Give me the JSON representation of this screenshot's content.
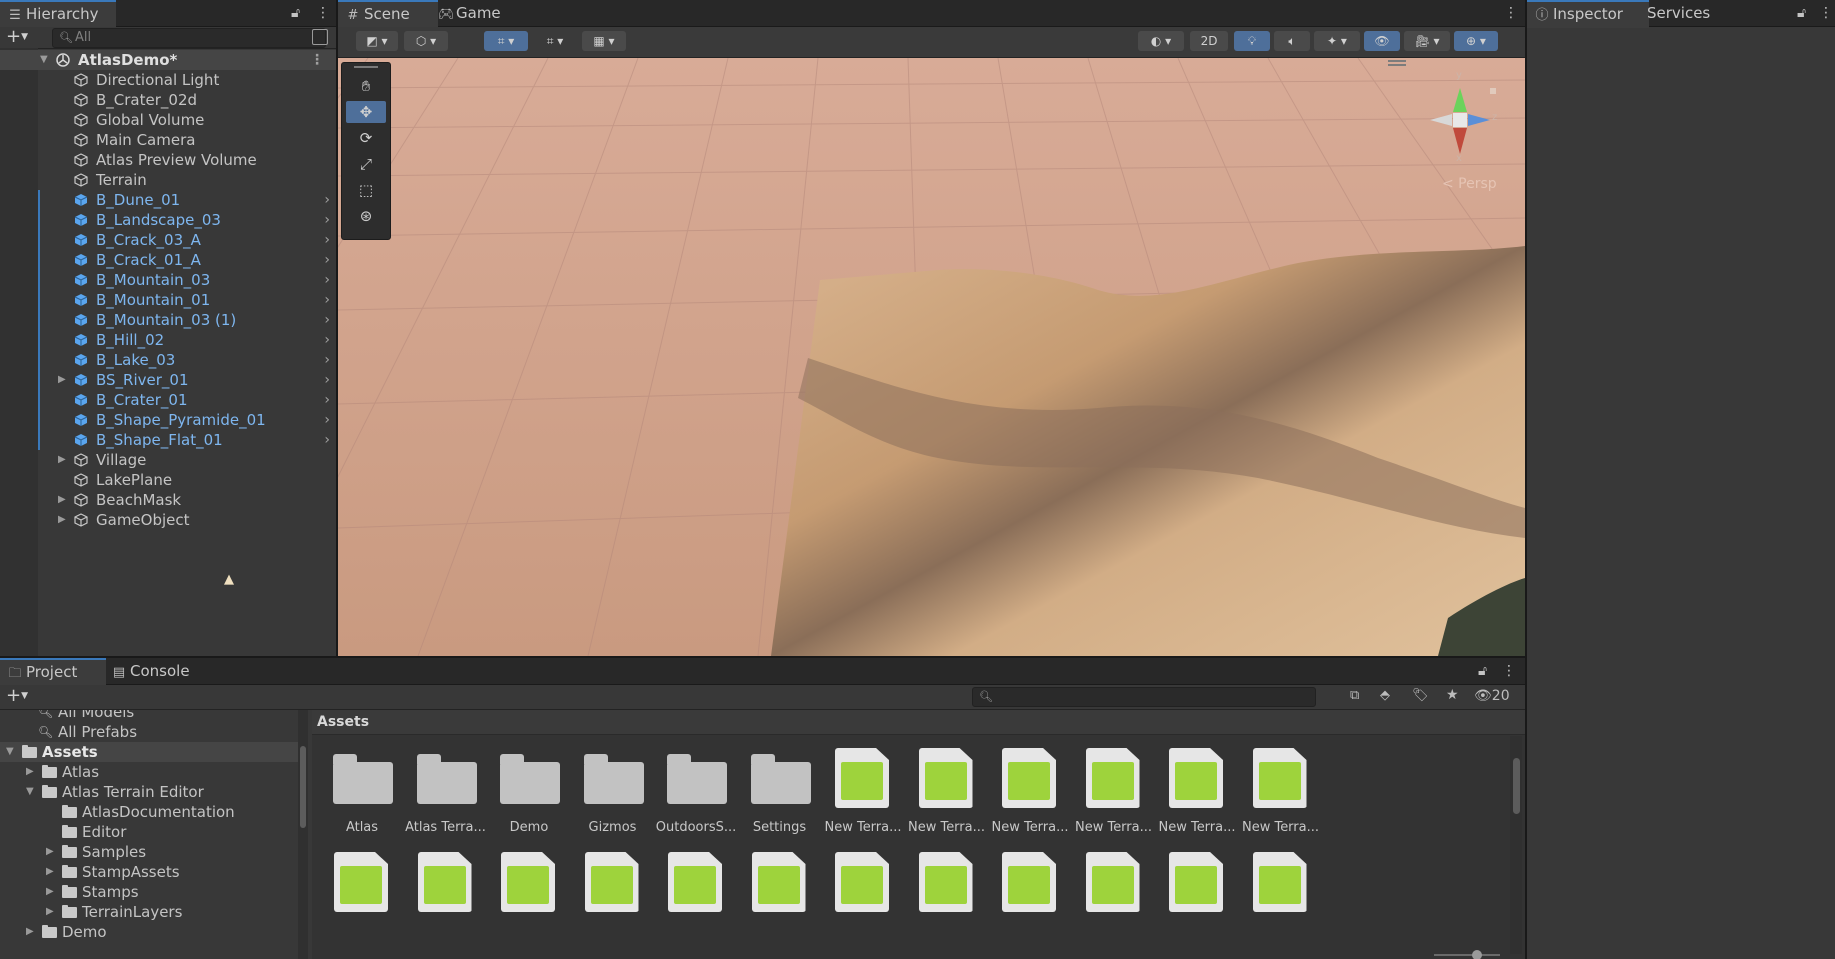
{
  "hierarchy": {
    "tab_label": "Hierarchy",
    "search_placeholder": "All",
    "scene_name": "AtlasDemo*",
    "items": [
      {
        "label": "Directional Light",
        "prefab": false,
        "fold": false
      },
      {
        "label": "B_Crater_02d",
        "prefab": false,
        "fold": false
      },
      {
        "label": "Global Volume",
        "prefab": false,
        "fold": false
      },
      {
        "label": "Main Camera",
        "prefab": false,
        "fold": false
      },
      {
        "label": "Atlas Preview Volume",
        "prefab": false,
        "fold": false
      },
      {
        "label": "Terrain",
        "prefab": false,
        "fold": false
      },
      {
        "label": "B_Dune_01",
        "prefab": true,
        "fold": false
      },
      {
        "label": "B_Landscape_03",
        "prefab": true,
        "fold": false
      },
      {
        "label": "B_Crack_03_A",
        "prefab": true,
        "fold": false
      },
      {
        "label": "B_Crack_01_A",
        "prefab": true,
        "fold": false
      },
      {
        "label": "B_Mountain_03",
        "prefab": true,
        "fold": false
      },
      {
        "label": "B_Mountain_01",
        "prefab": true,
        "fold": false
      },
      {
        "label": "B_Mountain_03 (1)",
        "prefab": true,
        "fold": false
      },
      {
        "label": "B_Hill_02",
        "prefab": true,
        "fold": false
      },
      {
        "label": "B_Lake_03",
        "prefab": true,
        "fold": false
      },
      {
        "label": "BS_River_01",
        "prefab": true,
        "fold": true
      },
      {
        "label": "B_Crater_01",
        "prefab": true,
        "fold": false
      },
      {
        "label": "B_Shape_Pyramide_01",
        "prefab": true,
        "fold": false
      },
      {
        "label": "B_Shape_Flat_01",
        "prefab": true,
        "fold": false
      },
      {
        "label": "Village",
        "prefab": false,
        "fold": true
      },
      {
        "label": "LakePlane",
        "prefab": false,
        "fold": false
      },
      {
        "label": "BeachMask",
        "prefab": false,
        "fold": true
      },
      {
        "label": "GameObject",
        "prefab": false,
        "fold": true
      }
    ]
  },
  "scene": {
    "tab_scene": "Scene",
    "tab_game": "Game",
    "btn_2d": "2D",
    "gizmo_persp": "< Persp",
    "axis_y": "y",
    "axis_z": "z",
    "axis_x": "x"
  },
  "inspector": {
    "tab_inspector": "Inspector",
    "tab_services": "Services"
  },
  "project": {
    "tab_project": "Project",
    "tab_console": "Console",
    "hidden_count": "20",
    "breadcrumb": "Assets",
    "tree": [
      {
        "label": "All Models",
        "indent": 0,
        "kind": "search",
        "fold": ""
      },
      {
        "label": "All Prefabs",
        "indent": 0,
        "kind": "search",
        "fold": ""
      },
      {
        "label": "Assets",
        "indent": 0,
        "kind": "folder-open",
        "fold": "open",
        "sel": true
      },
      {
        "label": "Atlas",
        "indent": 1,
        "kind": "folder",
        "fold": "closed"
      },
      {
        "label": "Atlas Terrain Editor",
        "indent": 1,
        "kind": "folder-open",
        "fold": "open"
      },
      {
        "label": "AtlasDocumentation",
        "indent": 2,
        "kind": "folder",
        "fold": ""
      },
      {
        "label": "Editor",
        "indent": 2,
        "kind": "folder",
        "fold": ""
      },
      {
        "label": "Samples",
        "indent": 2,
        "kind": "folder",
        "fold": "closed"
      },
      {
        "label": "StampAssets",
        "indent": 2,
        "kind": "folder",
        "fold": "closed"
      },
      {
        "label": "Stamps",
        "indent": 2,
        "kind": "folder",
        "fold": "closed"
      },
      {
        "label": "TerrainLayers",
        "indent": 2,
        "kind": "folder",
        "fold": "closed"
      },
      {
        "label": "Demo",
        "indent": 1,
        "kind": "folder",
        "fold": "closed"
      }
    ],
    "assets_row1": [
      {
        "label": "Atlas",
        "kind": "folder"
      },
      {
        "label": "Atlas Terra...",
        "kind": "folder"
      },
      {
        "label": "Demo",
        "kind": "folder"
      },
      {
        "label": "Gizmos",
        "kind": "folder"
      },
      {
        "label": "OutdoorsS...",
        "kind": "folder"
      },
      {
        "label": "Settings",
        "kind": "folder"
      },
      {
        "label": "New Terra...",
        "kind": "terrain"
      },
      {
        "label": "New Terra...",
        "kind": "terrain"
      },
      {
        "label": "New Terra...",
        "kind": "terrain"
      },
      {
        "label": "New Terra...",
        "kind": "terrain"
      },
      {
        "label": "New Terra...",
        "kind": "terrain"
      },
      {
        "label": "New Terra...",
        "kind": "terrain"
      }
    ],
    "assets_row2_count": 12
  }
}
